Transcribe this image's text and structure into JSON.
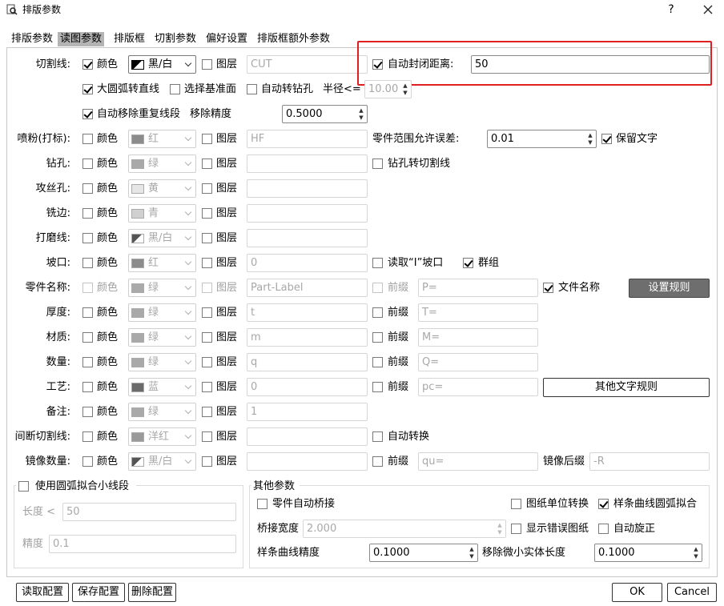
{
  "title": "排版参数",
  "tabs": [
    "排版参数",
    "读图参数",
    "排版框",
    "切割参数",
    "偏好设置",
    "排版框额外参数"
  ],
  "active_tab": 1,
  "labels": {
    "color": "颜色",
    "layer": "图层",
    "prefix": "前缀"
  },
  "cut": {
    "label": "切割线:",
    "color_value": "黑/白",
    "layer_value": "CUT",
    "auto_close_label": "自动封闭距离:",
    "auto_close_value": "50",
    "arc_to_line": "大圆弧转直线",
    "select_base": "选择基准面",
    "auto_drill": "自动转钻孔",
    "radius_label": "半径<=",
    "radius_value": "10.00",
    "remove_dup": "自动移除重复线段",
    "remove_prec_label": "移除精度",
    "remove_prec_value": "0.5000"
  },
  "rows": [
    {
      "label": "喷粉(打标):",
      "color": "红",
      "swatch": "#8c8c8c",
      "layer": "HF"
    },
    {
      "label": "钻孔:",
      "color": "绿",
      "swatch": "#a9a9a9",
      "layer": ""
    },
    {
      "label": "攻丝孔:",
      "color": "黄",
      "swatch": "#e6e6e6",
      "layer": ""
    },
    {
      "label": "铣边:",
      "color": "青",
      "swatch": "#d0d0d0",
      "layer": ""
    },
    {
      "label": "打磨线:",
      "color": "黑/白",
      "swatch": "diag",
      "layer": ""
    },
    {
      "label": "坡口:",
      "color": "红",
      "swatch": "#8c8c8c",
      "layer": "0"
    },
    {
      "label": "零件名称:",
      "color": "绿",
      "swatch": "#a9a9a9",
      "layer": "Part-Label",
      "prefix": "P="
    },
    {
      "label": "厚度:",
      "color": "绿",
      "swatch": "#a9a9a9",
      "layer": "t",
      "prefix": "T="
    },
    {
      "label": "材质:",
      "color": "绿",
      "swatch": "#a9a9a9",
      "layer": "m",
      "prefix": "M="
    },
    {
      "label": "数量:",
      "color": "绿",
      "swatch": "#a9a9a9",
      "layer": "q",
      "prefix": "Q="
    },
    {
      "label": "工艺:",
      "color": "蓝",
      "swatch": "#6b6b6b",
      "layer": "0",
      "prefix": "pc="
    },
    {
      "label": "备注:",
      "color": "绿",
      "swatch": "#a9a9a9",
      "layer": "1"
    },
    {
      "label": "间断切割线:",
      "color": "洋红",
      "swatch": "#9a9a9a",
      "layer": ""
    },
    {
      "label": "镜像数量:",
      "color": "黑/白",
      "swatch": "diag",
      "layer": "",
      "prefix": "qu="
    }
  ],
  "extras": {
    "tolerance_label": "零件范围允许误差:",
    "tolerance_value": "0.01",
    "keep_text": "保留文字",
    "drill_to_cut": "钻孔转切割线",
    "read_bevel": "读取“I”坡口",
    "group": "群组",
    "file_name": "文件名称",
    "set_rule": "设置规则",
    "other_text_rule": "其他文字规则",
    "auto_convert": "自动转换",
    "mirror_suffix_label": "镜像后缀",
    "mirror_suffix_value": "-R"
  },
  "arc_group": {
    "title": "使用圆弧拟合小线段",
    "length_label": "长度 <",
    "length_value": "50",
    "precision_label": "精度",
    "precision_value": "0.1"
  },
  "other_group": {
    "title": "其他参数",
    "auto_bridge": "零件自动桥接",
    "unit_convert": "图纸单位转换",
    "spline_arc": "样条曲线圆弧拟合",
    "bridge_width_label": "桥接宽度",
    "bridge_width_value": "2.000",
    "show_error": "显示错误图纸",
    "auto_rotate": "自动旋正",
    "spline_prec_label": "样条曲线精度",
    "spline_prec_value": "0.1000",
    "remove_small_label": "移除微小实体长度",
    "remove_small_value": "0.1000"
  },
  "footer": {
    "read_config": "读取配置",
    "save_config": "保存配置",
    "delete_config": "删除配置",
    "ok": "OK",
    "cancel": "Cancel"
  }
}
